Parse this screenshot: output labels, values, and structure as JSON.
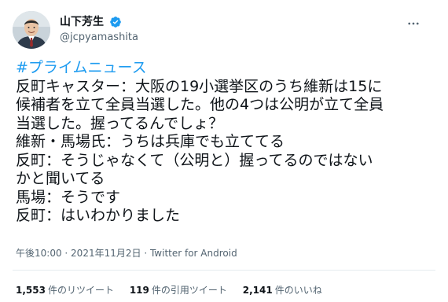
{
  "user": {
    "display_name": "山下芳生",
    "handle": "@jcpyamashita",
    "verified": true
  },
  "tweet": {
    "hashtag": "#プライムニュース",
    "lines": [
      "反町キャスター：大阪の19小選挙区のうち維新は15に",
      "候補者を立て全員当選した。他の4つは公明が立て全員",
      "当選した。握ってるんでしょ？",
      "維新・馬場氏：うちは兵庫でも立ててる",
      "反町：そうじゃなくて（公明と）握ってるのではない",
      "かと聞いてる",
      "馬場：そうです",
      "反町：はいわかりました"
    ]
  },
  "meta": {
    "time": "午後10:00",
    "separator1": " · ",
    "date": "2021年11月2日",
    "separator2": " · ",
    "source": "Twitter for Android"
  },
  "stats": {
    "retweets_count": "1,553",
    "retweets_label": "件のリツイート",
    "quotes_count": "119",
    "quotes_label": "件の引用ツイート",
    "likes_count": "2,141",
    "likes_label": "件のいいね"
  },
  "icons": {
    "verified": "verified-badge-icon",
    "more": "more-horizontal-icon"
  },
  "colors": {
    "accent": "#1d9bf0",
    "text": "#0f1419",
    "secondary": "#536471",
    "divider": "#e6ecf0"
  }
}
